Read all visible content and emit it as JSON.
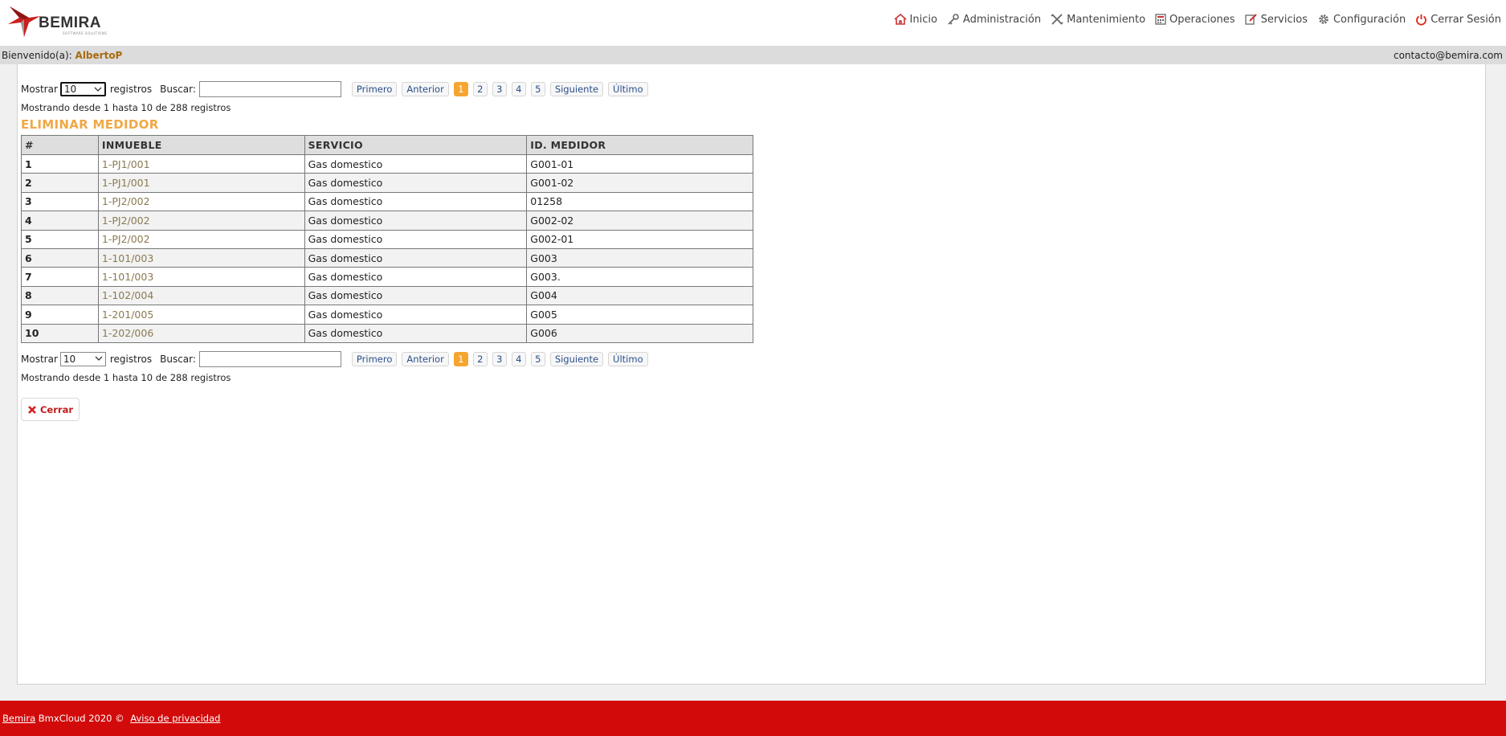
{
  "brand": {
    "name": "BEMIRA",
    "tagline": "SOFTWARE SOLUTIONS"
  },
  "nav": [
    {
      "label": "Inicio",
      "icon": "home-icon"
    },
    {
      "label": "Administración",
      "icon": "key-icon"
    },
    {
      "label": "Mantenimiento",
      "icon": "tools-icon"
    },
    {
      "label": "Operaciones",
      "icon": "calculator-icon"
    },
    {
      "label": "Servicios",
      "icon": "edit-icon"
    },
    {
      "label": "Configuración",
      "icon": "gear-icon"
    },
    {
      "label": "Cerrar Sesión",
      "icon": "power-icon"
    }
  ],
  "welcome": {
    "prefix": "Bienvenido(a):",
    "user": "AlbertoP",
    "contact": "contacto@bemira.com"
  },
  "list_controls": {
    "show_label": "Mostrar",
    "page_size": "10",
    "records_label": "registros",
    "search_label": "Buscar:",
    "search_value": "",
    "first": "Primero",
    "previous": "Anterior",
    "pages": [
      "1",
      "2",
      "3",
      "4",
      "5"
    ],
    "current_page": "1",
    "next": "Siguiente",
    "last": "Último",
    "info": "Mostrando desde 1 hasta 10 de 288 registros"
  },
  "page_title": "ELIMINAR MEDIDOR",
  "table": {
    "headers": [
      "#",
      "INMUEBLE",
      "SERVICIO",
      "ID. MEDIDOR"
    ],
    "rows": [
      [
        "1",
        "1-PJ1/001",
        "Gas domestico",
        "G001-01"
      ],
      [
        "2",
        "1-PJ1/001",
        "Gas domestico",
        "G001-02"
      ],
      [
        "3",
        "1-PJ2/002",
        "Gas domestico",
        "01258"
      ],
      [
        "4",
        "1-PJ2/002",
        "Gas domestico",
        "G002-02"
      ],
      [
        "5",
        "1-PJ2/002",
        "Gas domestico",
        "G002-01"
      ],
      [
        "6",
        "1-101/003",
        "Gas domestico",
        "G003"
      ],
      [
        "7",
        "1-101/003",
        "Gas domestico",
        "G003."
      ],
      [
        "8",
        "1-102/004",
        "Gas domestico",
        "G004"
      ],
      [
        "9",
        "1-201/005",
        "Gas domestico",
        "G005"
      ],
      [
        "10",
        "1-202/006",
        "Gas domestico",
        "G006"
      ]
    ]
  },
  "close_button": "Cerrar",
  "footer": {
    "brand_link": "Bemira",
    "text": "BmxCloud 2020 ©",
    "privacy_link": "Aviso de privacidad"
  },
  "colors": {
    "accent": "#f6a531",
    "footer": "#d20a0a",
    "title": "#f0a846"
  }
}
